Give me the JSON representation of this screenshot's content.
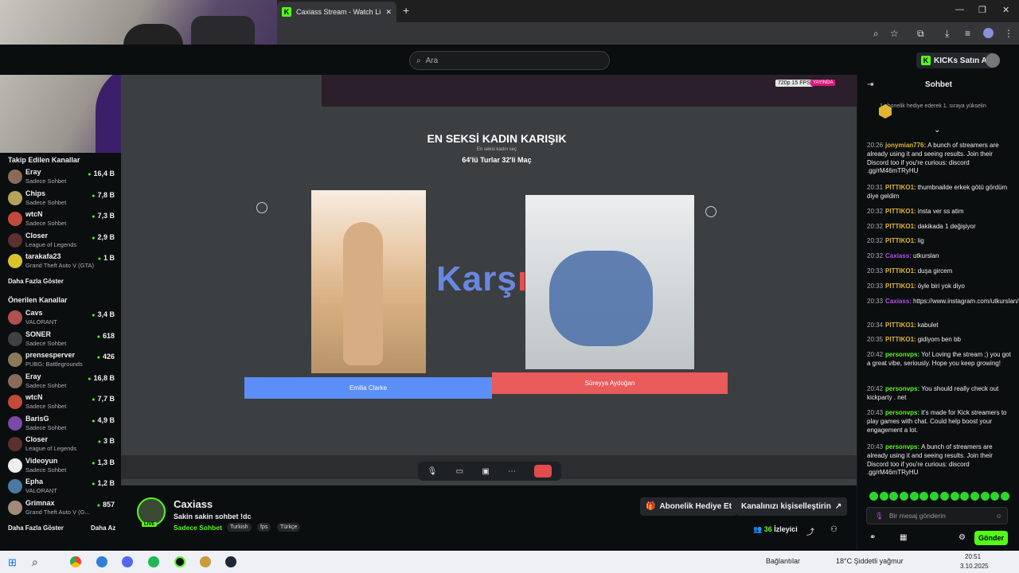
{
  "browser": {
    "tab_title": "Caxiass Stream - Watch Live",
    "new_tab": "+",
    "win_min": "—",
    "win_max": "❐",
    "win_close": "✕"
  },
  "header": {
    "search_placeholder": "Ara",
    "buy_kicks": "KICKs Satın Al"
  },
  "sidebar": {
    "followed_title": "Takip Edilen Kanallar",
    "followed": [
      {
        "name": "Eray",
        "category": "Sadece Sohbet",
        "viewers": "16,4 B",
        "color": "#8a6a5a"
      },
      {
        "name": "Chips",
        "category": "Sadece Sohbet",
        "viewers": "7,8 B",
        "color": "#b7a25b"
      },
      {
        "name": "wtcN",
        "category": "Sadece Sohbet",
        "viewers": "7,3 B",
        "color": "#c24a3a"
      },
      {
        "name": "Closer",
        "category": "League of Legends",
        "viewers": "2,9 B",
        "color": "#5a3030"
      },
      {
        "name": "tarakafa23",
        "category": "Grand Theft Auto V (GTA)",
        "viewers": "1 B",
        "color": "#d9c32a"
      }
    ],
    "followed_more": "Daha Fazla Göster",
    "recommended_title": "Önerilen Kanallar",
    "recommended": [
      {
        "name": "Cavs",
        "category": "VALORANT",
        "viewers": "3,4 B",
        "color": "#b05050"
      },
      {
        "name": "SONER",
        "category": "Sadece Sohbet",
        "viewers": "618",
        "color": "#404040"
      },
      {
        "name": "prensesperver",
        "category": "PUBG: Battlegrounds",
        "viewers": "426",
        "color": "#8a7a5a"
      },
      {
        "name": "Eray",
        "category": "Sadece Sohbet",
        "viewers": "16,8 B",
        "color": "#8a6a5a"
      },
      {
        "name": "wtcN",
        "category": "Sadece Sohbet",
        "viewers": "7,7 B",
        "color": "#c24a3a"
      },
      {
        "name": "BarisG",
        "category": "Sadece Sohbet",
        "viewers": "4,9 B",
        "color": "#7b4aa8"
      },
      {
        "name": "Closer",
        "category": "League of Legends",
        "viewers": "3 B",
        "color": "#5a3030"
      },
      {
        "name": "Videoyun",
        "category": "Sadece Sohbet",
        "viewers": "1,3 B",
        "color": "#eeeeee"
      },
      {
        "name": "Epha",
        "category": "VALORANT",
        "viewers": "1,2 B",
        "color": "#4a7aa0"
      },
      {
        "name": "Grimnax",
        "category": "Grand Theft Auto V (G...",
        "viewers": "857",
        "color": "#a08a7a"
      }
    ],
    "more": "Daha Fazla Göster",
    "less": "Daha Az"
  },
  "video": {
    "quality_badge": "720p 15 FPS",
    "live_badge": "YAYINDA",
    "title": "EN SEKSİ KADIN KARIŞIK",
    "subtitle": "En seksi kadın seç",
    "round": "64'lü Turlar 32'li Maç",
    "versus_a": "Karş",
    "versus_b": "ı",
    "left_name": "Emilia Clarke",
    "right_name": "Süreyya Aydoğan"
  },
  "stream": {
    "channel": "Caxiass",
    "live": "LIVE",
    "title": "Sakin sakin sohbet !dc",
    "category": "Sadece Sohbet",
    "tags": [
      "Turkish",
      "fps",
      "Türkçe"
    ],
    "gift_button": "Abonelik Hediye Et",
    "customize_button": "Kanalınızı kişiselleştirin",
    "viewers_count": "36",
    "viewers_label": "İzleyici"
  },
  "chat": {
    "title": "Sohbet",
    "pinned": "1 abonelik hediye ederek 1. sıraya yükselin",
    "messages": [
      {
        "time": "20:26",
        "user": "jonymian776:",
        "color": "#e0b534",
        "text": "A bunch of streamers are already using it and seeing results. Join their Discord too if you're curious: discord .gg/rM46mTRyHU"
      },
      {
        "time": "20:31",
        "user": "PITTIKO1:",
        "color": "#e0b534",
        "text": "thumbnailde erkek götü gördüm diye geldim"
      },
      {
        "time": "20:32",
        "user": "PITTIKO1:",
        "color": "#e0b534",
        "text": "insta ver ss atim"
      },
      {
        "time": "20:32",
        "user": "PITTIKO1:",
        "color": "#e0b534",
        "text": "dakikada 1 değişiyor"
      },
      {
        "time": "20:32",
        "user": "PITTIKO1:",
        "color": "#e0b534",
        "text": "lig"
      },
      {
        "time": "20:32",
        "user": "Caxiass:",
        "color": "#b44ee8",
        "text": "utkurslan"
      },
      {
        "time": "20:33",
        "user": "PITTIKO1:",
        "color": "#e0b534",
        "text": "duşa gircem"
      },
      {
        "time": "20:33",
        "user": "PITTIKO1:",
        "color": "#e0b534",
        "text": "öyle biri yok diyo"
      },
      {
        "time": "20:33",
        "user": "Caxiass:",
        "color": "#b44ee8",
        "text": "https://www.instagram.com/utkurslan/"
      },
      {
        "time": "20:34",
        "user": "PITTIKO1:",
        "color": "#e0b534",
        "text": "kabulet"
      },
      {
        "time": "20:35",
        "user": "PITTIKO1:",
        "color": "#e0b534",
        "text": "gidiyom ben bb"
      },
      {
        "time": "20:42",
        "user": "personvps:",
        "color": "#53fc18",
        "text": "Yo! Loving the stream ;) you got a great vibe, seriously. Hope you keep growing!"
      },
      {
        "time": "20:42",
        "user": "personvps:",
        "color": "#53fc18",
        "text": "You should really check out kickparty . net"
      },
      {
        "time": "20:43",
        "user": "personvps:",
        "color": "#53fc18",
        "text": "it's made for Kick streamers to play games with chat. Could help boost your engagement a lot."
      },
      {
        "time": "20:43",
        "user": "personvps:",
        "color": "#53fc18",
        "text": "A bunch of streamers are already using it and seeing results. Join their Discord too if you're curious: discord .gg/rM46mTRyHU"
      }
    ],
    "input_placeholder": "Bir mesaj gönderin",
    "send": "Gönder"
  },
  "taskbar": {
    "network": "Bağlantılar",
    "weather": "18°C  Şiddetli yağmur",
    "time": "20:51",
    "date": "3.10.2025"
  }
}
